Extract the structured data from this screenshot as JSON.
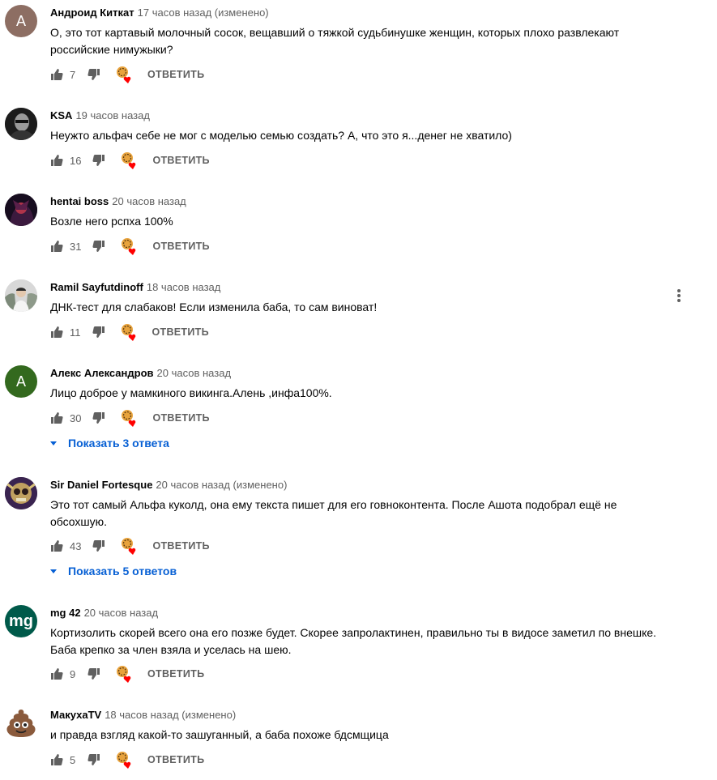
{
  "action_labels": {
    "reply": "ОТВЕТИТЬ"
  },
  "colors": {
    "link": "#065fd4",
    "meta": "#606060",
    "heart": "#ff0000"
  },
  "comments": [
    {
      "author": "Андроид Киткат",
      "time": "17 часов назад (изменено)",
      "text": "О, это тот картавый молочный сосок, вещавший о тяжкой судьбинушке женщин, которых плохо развлекают российские нимужыки?",
      "likes": "7",
      "avatar": {
        "type": "letter",
        "letter": "A",
        "bg": "#8d6e63"
      }
    },
    {
      "author": "KSA",
      "time": "19 часов назад",
      "text": "Неужто альфач себе не мог с моделью семью создать? А, что это я...денег не хватило)",
      "likes": "16",
      "avatar": {
        "type": "photo",
        "icon": "bw-face-photo"
      }
    },
    {
      "author": "hentai boss",
      "time": "20 часов назад",
      "text": "Возле него рспха 100%",
      "likes": "31",
      "avatar": {
        "type": "photo",
        "icon": "dark-anime-photo"
      }
    },
    {
      "author": "Ramil Sayfutdinoff",
      "time": "18 часов назад",
      "text": "ДНК-тест для слабаков! Если изменила баба, то сам виноват!",
      "likes": "11",
      "avatar": {
        "type": "photo",
        "icon": "person-photo"
      }
    },
    {
      "author": "Алекс Александров",
      "time": "20 часов назад",
      "text": "Лицо доброе у мамкиного викинга.Алень ,инфа100%.",
      "likes": "30",
      "avatar": {
        "type": "letter",
        "letter": "A",
        "bg": "#33691e"
      },
      "replies": "Показать 3 ответа"
    },
    {
      "author": "Sir Daniel Fortesque",
      "time": "20 часов назад (изменено)",
      "text": "Это тот самый Альфа куколд, она ему текста пишет для его говноконтента. После Ашота подобрал ещё не обсохшую.",
      "likes": "43",
      "avatar": {
        "type": "photo",
        "icon": "skull-character-photo"
      },
      "replies": "Показать 5 ответов"
    },
    {
      "author": "mg 42",
      "time": "20 часов назад",
      "text": "Кортизолить скорей всего она его позже будет. Скорее запролактинен, правильно ты в видосе заметил по внешке. Баба крепко за член взяла и уселась на шею.",
      "likes": "9",
      "avatar": {
        "type": "letter",
        "letter": "mg",
        "bg": "#005a4a"
      }
    },
    {
      "author": "МакухаTV",
      "time": "18 часов назад (изменено)",
      "text": "и правда взгляд какой-то зашуганный, а баба похоже бдсмщица",
      "likes": "5",
      "avatar": {
        "type": "emoji",
        "icon": "poop-emoji"
      }
    }
  ]
}
